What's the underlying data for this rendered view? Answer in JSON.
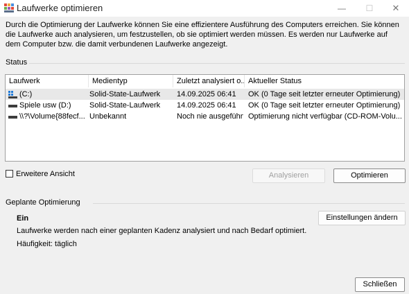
{
  "window": {
    "title": "Laufwerke optimieren",
    "minimize_glyph": "—",
    "maximize_glyph": "☐",
    "close_glyph": "✕"
  },
  "description": "Durch die Optimierung der Laufwerke können Sie eine effizientere Ausführung des Computers erreichen. Sie können die Laufwerke auch analysieren, um festzustellen, ob sie optimiert werden müssen. Es werden nur Laufwerke auf dem Computer bzw. die damit verbundenen Laufwerke angezeigt.",
  "status": {
    "label": "Status",
    "columns": [
      "Laufwerk",
      "Medientyp",
      "Zuletzt analysiert o...",
      "Aktueller Status"
    ],
    "rows": [
      {
        "drive": "(C:)",
        "media": "Solid-State-Laufwerk",
        "last": "14.09.2025 06:41",
        "status": "OK (0 Tage seit letzter erneuter Optimierung)",
        "icon": "windows-drive-icon",
        "selected": true
      },
      {
        "drive": "Spiele usw (D:)",
        "media": "Solid-State-Laufwerk",
        "last": "14.09.2025 06:41",
        "status": "OK (0 Tage seit letzter erneuter Optimierung)",
        "icon": "drive-icon",
        "selected": false
      },
      {
        "drive": "\\\\?\\Volume{88fecf...",
        "media": "Unbekannt",
        "last": "Noch nie ausgeführt",
        "status": "Optimierung nicht verfügbar (CD-ROM-Volu...",
        "icon": "drive-icon",
        "selected": false
      }
    ]
  },
  "advanced_view": {
    "label": "Erweitere Ansicht",
    "checked": false
  },
  "buttons": {
    "analyze": "Analysieren",
    "optimize": "Optimieren",
    "settings": "Einstellungen ändern",
    "close": "Schließen"
  },
  "scheduled": {
    "label": "Geplante Optimierung",
    "state": "Ein",
    "description": "Laufwerke werden nach einer geplanten Kadenz analysiert und nach Bedarf optimiert.",
    "frequency": "Häufigkeit: täglich"
  },
  "colors": {
    "selection": "#e8e8e8",
    "windows_blue": "#1f7ad8"
  }
}
